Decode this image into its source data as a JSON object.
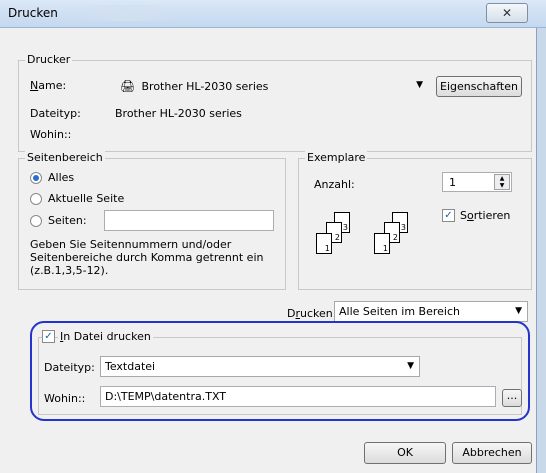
{
  "window": {
    "title": "Drucken",
    "close_glyph": "✕"
  },
  "printer": {
    "group_label": "Drucker",
    "name_label": "Name:",
    "name_value": "Brother HL-2030 series",
    "properties_button": "Eigenschaften",
    "type_label": "Dateityp:",
    "type_value": "Brother HL-2030 series",
    "where_label": "Wohin::",
    "where_value": ""
  },
  "range": {
    "group_label": "Seitenbereich",
    "all_label": "Alles",
    "current_label": "Aktuelle Seite",
    "pages_label": "Seiten:",
    "pages_value": "",
    "selected": "all",
    "help_text": "Geben Sie Seitennummern und/oder Seitenbereiche durch Komma getrennt ein (z.B.1,3,5-12)."
  },
  "copies": {
    "group_label": "Exemplare",
    "count_label": "Anzahl:",
    "count_value": "1",
    "collate_label": "Sortieren",
    "collate_checked": true,
    "stack_pages": [
      "1",
      "2",
      "3"
    ]
  },
  "print_what": {
    "label": "Drucken",
    "value": "Alle Seiten im Bereich"
  },
  "print_to_file": {
    "label": "In Datei drucken",
    "checked": true,
    "type_label": "Dateityp:",
    "type_value": "Textdatei",
    "where_label": "Wohin::",
    "where_value": "D:\\TEMP\\datentra.TXT",
    "browse_label": "..."
  },
  "buttons": {
    "ok": "OK",
    "cancel": "Abbrechen"
  },
  "colors": {
    "highlight": "#2433cc",
    "checkmark": "#1a5bb0",
    "radio_dot": "#2a6ccf"
  }
}
